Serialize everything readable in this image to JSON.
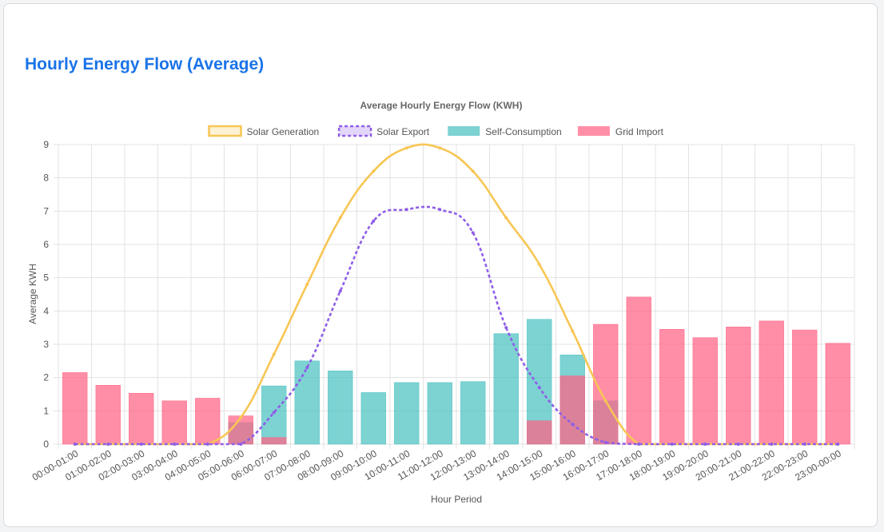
{
  "card": {
    "title": "Hourly Energy Flow (Average)"
  },
  "colors": {
    "solar": "#f7c654",
    "export": "#8f5de8",
    "self": "#4bc0c0",
    "grid": "#ff6384",
    "titleBlue": "#1a73e8"
  },
  "chart_data": {
    "type": "bar",
    "title": "Average Hourly Energy Flow (KWH)",
    "xlabel": "Hour Period",
    "ylabel": "Average KWH",
    "ylim": [
      0,
      9
    ],
    "yticks": [
      0,
      1,
      2,
      3,
      4,
      5,
      6,
      7,
      8,
      9
    ],
    "grid": true,
    "legend_position": "top",
    "categories": [
      "00:00-01:00",
      "01:00-02:00",
      "02:00-03:00",
      "03:00-04:00",
      "04:00-05:00",
      "05:00-06:00",
      "06:00-07:00",
      "07:00-08:00",
      "08:00-09:00",
      "09:00-10:00",
      "10:00-11:00",
      "11:00-12:00",
      "12:00-13:00",
      "13:00-14:00",
      "14:00-15:00",
      "15:00-16:00",
      "16:00-17:00",
      "17:00-18:00",
      "18:00-19:00",
      "19:00-20:00",
      "20:00-21:00",
      "21:00-22:00",
      "22:00-23:00",
      "23:00-00:00"
    ],
    "series": [
      {
        "name": "Solar Generation",
        "kind": "line",
        "style": "solid",
        "color": "#f7c654",
        "values": [
          0,
          0,
          0,
          0,
          0,
          0.8,
          2.7,
          4.8,
          6.8,
          8.2,
          8.9,
          8.9,
          8.2,
          6.8,
          5.4,
          3.4,
          1.3,
          0,
          0,
          0,
          0,
          0,
          0,
          0
        ]
      },
      {
        "name": "Solar Export",
        "kind": "line",
        "style": "dashed",
        "color": "#8f5de8",
        "values": [
          0,
          0,
          0,
          0,
          0,
          0,
          0.95,
          2.3,
          4.6,
          6.7,
          7.05,
          7.05,
          6.35,
          3.5,
          1.7,
          0.6,
          0.05,
          0,
          0,
          0,
          0,
          0,
          0,
          0
        ]
      },
      {
        "name": "Self-Consumption",
        "kind": "bar",
        "color": "#4bc0c0",
        "values": [
          0,
          0,
          0,
          0,
          0,
          0.65,
          1.75,
          2.5,
          2.2,
          1.55,
          1.85,
          1.85,
          1.88,
          3.32,
          3.75,
          2.68,
          1.3,
          0,
          0,
          0,
          0,
          0,
          0,
          0
        ]
      },
      {
        "name": "Grid Import",
        "kind": "bar",
        "color": "#ff6384",
        "values": [
          2.15,
          1.77,
          1.53,
          1.3,
          1.38,
          0.85,
          0.2,
          0,
          0,
          0,
          0,
          0,
          0,
          0,
          0.7,
          2.05,
          3.6,
          4.42,
          3.45,
          3.2,
          3.52,
          3.7,
          3.43,
          3.03
        ]
      }
    ]
  }
}
